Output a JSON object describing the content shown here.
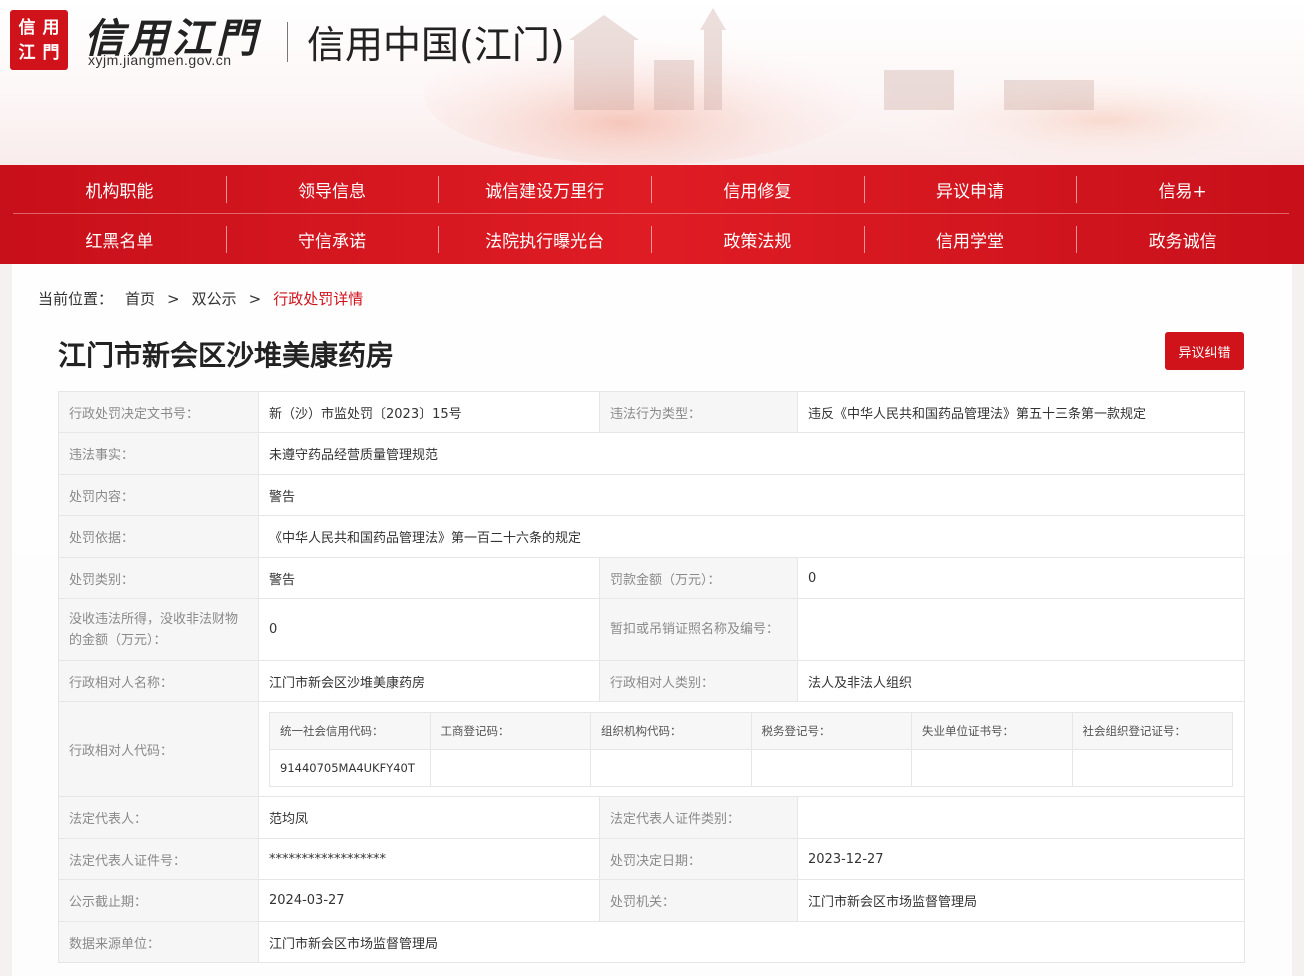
{
  "site": {
    "seal_chars": [
      "信",
      "用",
      "江",
      "門"
    ],
    "logo_text": "信用江門",
    "domain": "xyjm.jiangmen.gov.cn",
    "title": "信用中国(江门)"
  },
  "nav": {
    "row1": [
      "机构职能",
      "领导信息",
      "诚信建设万里行",
      "信用修复",
      "异议申请",
      "信易+"
    ],
    "row2": [
      "红黑名单",
      "守信承诺",
      "法院执行曝光台",
      "政策法规",
      "信用学堂",
      "政务诚信"
    ]
  },
  "breadcrumb": {
    "label": "当前位置：",
    "home": "首页",
    "sep": ">",
    "section": "双公示",
    "current": "行政处罚详情"
  },
  "page_title": "江门市新会区沙堆美康药房",
  "objection_button": "异议纠错",
  "detail": {
    "decision_no_k": "行政处罚决定文书号：",
    "decision_no_v": "新（沙）市监处罚〔2023〕15号",
    "violation_type_k": "违法行为类型：",
    "violation_type_v": "违反《中华人民共和国药品管理法》第五十三条第一款规定",
    "facts_k": "违法事实：",
    "facts_v": "未遵守药品经营质量管理规范",
    "content_k": "处罚内容：",
    "content_v": "警告",
    "basis_k": "处罚依据：",
    "basis_v": "《中华人民共和国药品管理法》第一百二十六条的规定",
    "category_k": "处罚类别：",
    "category_v": "警告",
    "fine_k": "罚款金额（万元）：",
    "fine_v": "0",
    "confiscation_k": "没收违法所得，没收非法财物的金额（万元）：",
    "confiscation_v": "0",
    "license_k": "暂扣或吊销证照名称及编号：",
    "license_v": "",
    "party_name_k": "行政相对人名称：",
    "party_name_v": "江门市新会区沙堆美康药房",
    "party_type_k": "行政相对人类别：",
    "party_type_v": "法人及非法人组织",
    "party_code_k": "行政相对人代码：",
    "codes": {
      "headers": [
        "统一社会信用代码：",
        "工商登记码：",
        "组织机构代码：",
        "税务登记号：",
        "失业单位证书号：",
        "社会组织登记证号："
      ],
      "values": [
        "91440705MA4UKFY40T",
        "",
        "",
        "",
        "",
        ""
      ]
    },
    "legal_rep_k": "法定代表人：",
    "legal_rep_v": "范均凤",
    "legal_id_type_k": "法定代表人证件类别：",
    "legal_id_type_v": "",
    "legal_id_no_k": "法定代表人证件号：",
    "legal_id_no_v": "******************",
    "decision_date_k": "处罚决定日期：",
    "decision_date_v": "2023-12-27",
    "publish_end_k": "公示截止期：",
    "publish_end_v": "2024-03-27",
    "authority_k": "处罚机关：",
    "authority_v": "江门市新会区市场监督管理局",
    "source_k": "数据来源单位：",
    "source_v": "江门市新会区市场监督管理局"
  },
  "colors": {
    "brand_red": "#d0121b",
    "nav_red": "#df1c24"
  }
}
